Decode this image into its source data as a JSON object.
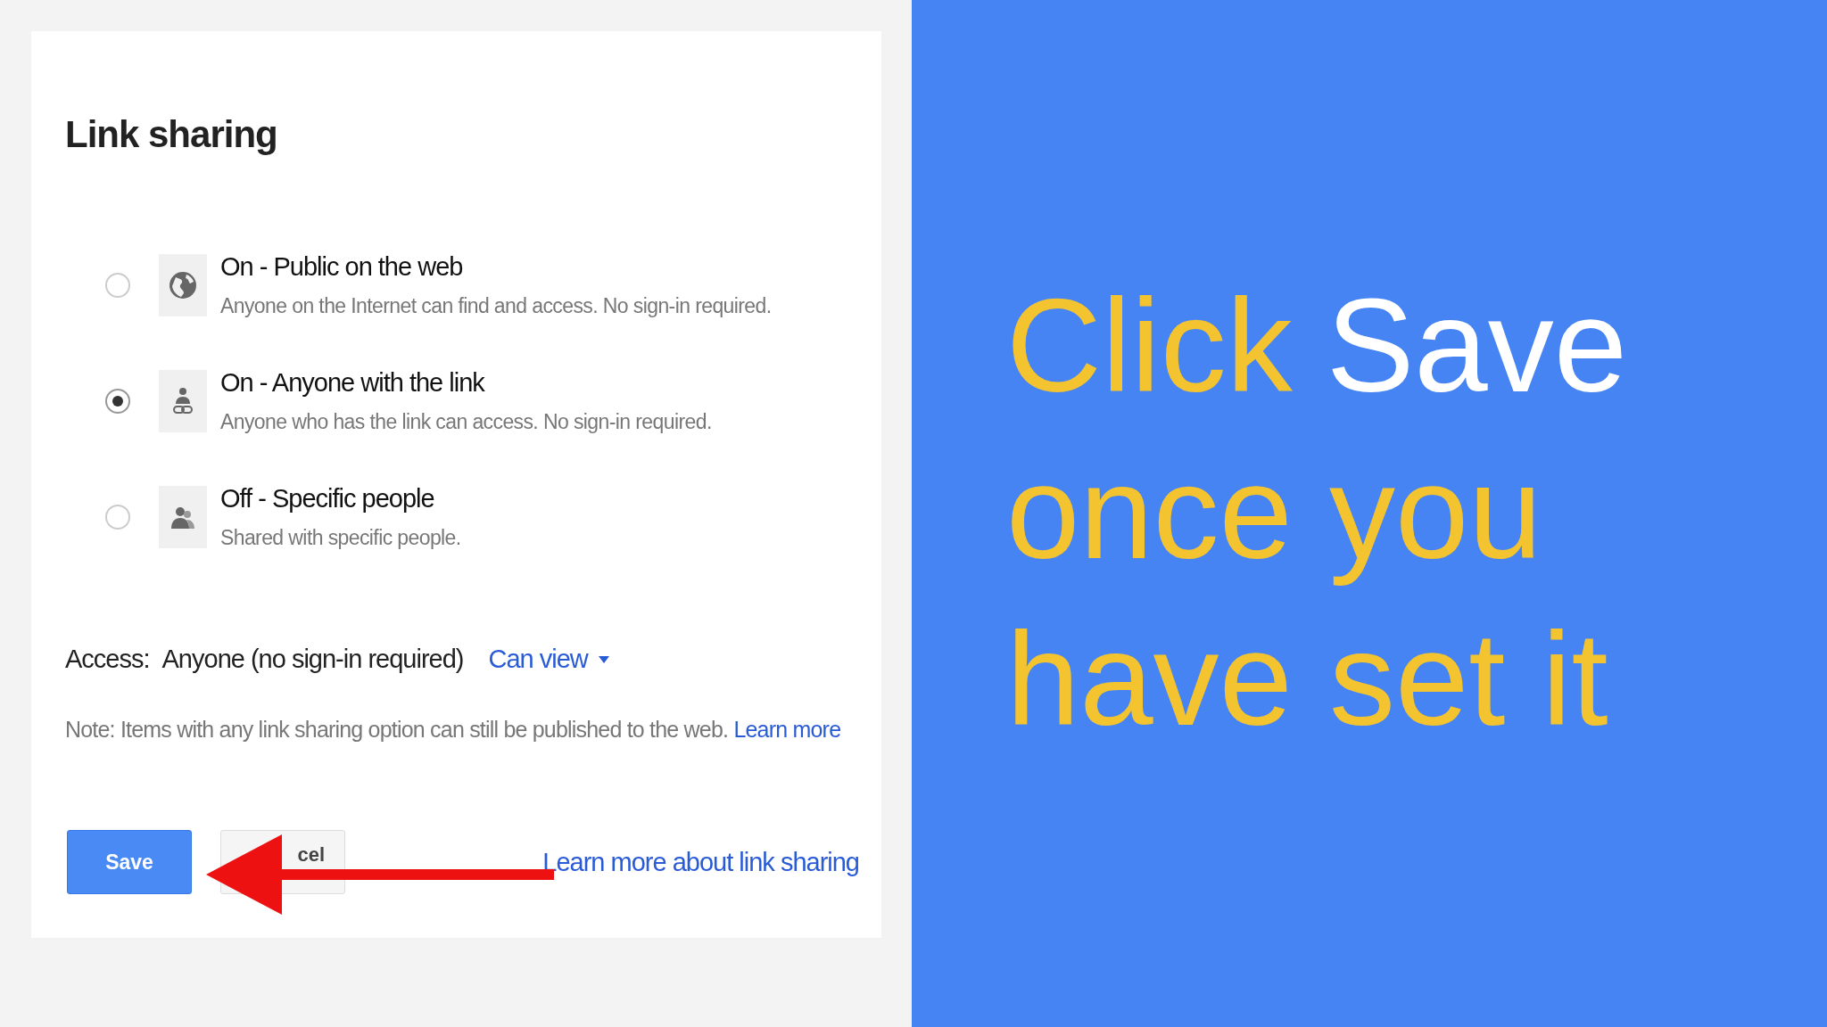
{
  "dialog": {
    "title": "Link sharing",
    "options": [
      {
        "kind": "globe",
        "title": "On - Public on the web",
        "description": "Anyone on the Internet can find and access. No sign-in required.",
        "selected": false
      },
      {
        "kind": "link-person",
        "title": "On - Anyone with the link",
        "description": "Anyone who has the link can access. No sign-in required.",
        "selected": true
      },
      {
        "kind": "people",
        "title": "Off - Specific people",
        "description": "Shared with specific people.",
        "selected": false
      }
    ],
    "access": {
      "label": "Access:",
      "value": "Anyone (no sign-in required)",
      "permission": "Can view"
    },
    "note": {
      "text": "Note: Items with any link sharing option can still be published to the web.",
      "link": "Learn more"
    },
    "buttons": [
      {
        "kind": "primary",
        "label": "Save"
      },
      {
        "kind": "secondary",
        "label": "cel"
      }
    ],
    "help_link": "Learn more about link sharing"
  },
  "headline": [
    [
      {
        "text": "Click",
        "emphasis": false
      },
      {
        "text": "Save",
        "emphasis": true
      }
    ],
    [
      {
        "text": "once you",
        "emphasis": false
      }
    ],
    [
      {
        "text": "have set it",
        "emphasis": false
      }
    ]
  ]
}
